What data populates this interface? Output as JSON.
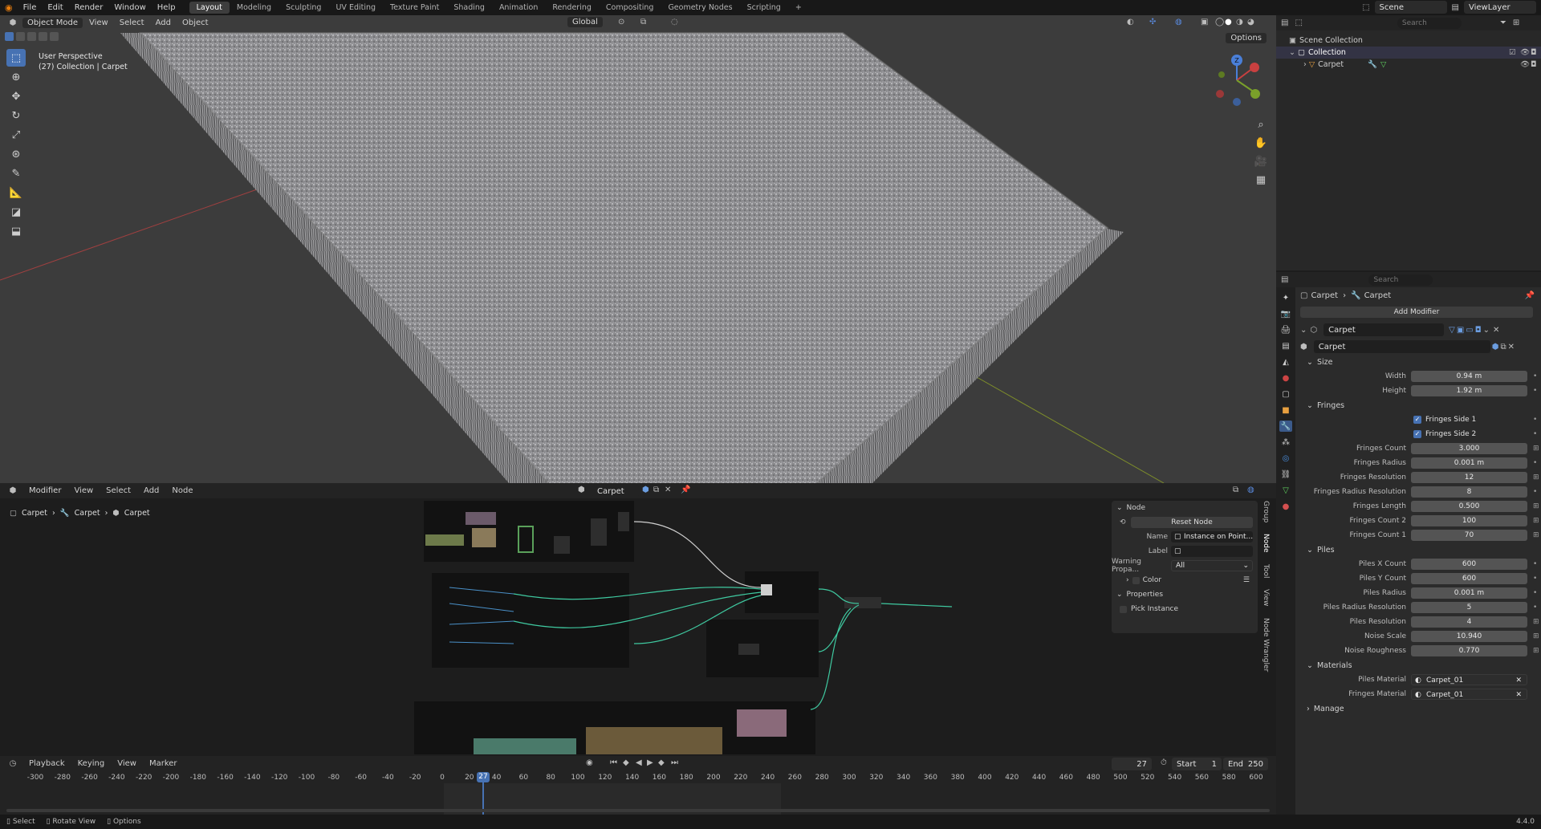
{
  "topbar": {
    "menus": [
      "File",
      "Edit",
      "Render",
      "Window",
      "Help"
    ],
    "workspaces": [
      "Layout",
      "Modeling",
      "Sculpting",
      "UV Editing",
      "Texture Paint",
      "Shading",
      "Animation",
      "Rendering",
      "Compositing",
      "Geometry Nodes",
      "Scripting"
    ],
    "active_workspace": "Layout",
    "scene": "Scene",
    "view_layer": "ViewLayer"
  },
  "viewport": {
    "mode": "Object Mode",
    "menus": [
      "View",
      "Select",
      "Add",
      "Object"
    ],
    "transform_orientation": "Global",
    "options": "Options",
    "info_line1": "User Perspective",
    "info_line2": "(27) Collection | Carpet",
    "gizmo_z": "Z"
  },
  "outliner": {
    "search_placeholder": "Search",
    "scene_collection": "Scene Collection",
    "collection": "Collection",
    "object": "Carpet"
  },
  "properties": {
    "search_placeholder": "Search",
    "breadcrumb": [
      "Carpet",
      "Carpet"
    ],
    "add_modifier": "Add Modifier",
    "modifier_name": "Carpet",
    "node_group": "Carpet",
    "size_section": "Size",
    "width_label": "Width",
    "width_value": "0.94 m",
    "height_label": "Height",
    "height_value": "1.92 m",
    "fringes_section": "Fringes",
    "fringes_side1": "Fringes Side 1",
    "fringes_side2": "Fringes Side 2",
    "fringe_rows": [
      {
        "label": "Fringes Count",
        "value": "3.000"
      },
      {
        "label": "Fringes Radius",
        "value": "0.001 m"
      },
      {
        "label": "Fringes Resolution",
        "value": "12"
      },
      {
        "label": "Fringes Radius Resolution",
        "value": "8"
      },
      {
        "label": "Fringes Length",
        "value": "0.500"
      },
      {
        "label": "Fringes Count 2",
        "value": "100"
      },
      {
        "label": "Fringes Count 1",
        "value": "70"
      }
    ],
    "piles_section": "Piles",
    "pile_rows": [
      {
        "label": "Piles X Count",
        "value": "600"
      },
      {
        "label": "Piles Y Count",
        "value": "600"
      },
      {
        "label": "Piles Radius",
        "value": "0.001 m"
      },
      {
        "label": "Piles Radius Resolution",
        "value": "5"
      },
      {
        "label": "Piles Resolution",
        "value": "4"
      },
      {
        "label": "Noise Scale",
        "value": "10.940"
      },
      {
        "label": "Noise Roughness",
        "value": "0.770"
      }
    ],
    "materials_section": "Materials",
    "piles_material_label": "Piles Material",
    "piles_material": "Carpet_01",
    "fringes_material_label": "Fringes Material",
    "fringes_material": "Carpet_01",
    "manage_section": "Manage"
  },
  "node_editor": {
    "editor_type": "Modifier",
    "menus": [
      "View",
      "Select",
      "Add",
      "Node"
    ],
    "node_group": "Carpet",
    "breadcrumb": [
      "Carpet",
      "Carpet",
      "Carpet"
    ],
    "panel": {
      "node_section": "Node",
      "reset_node": "Reset Node",
      "name_label": "Name",
      "name_value": "Instance on Point...",
      "label_label": "Label",
      "label_value": "",
      "warning_label": "Warning Propa...",
      "warning_value": "All",
      "color_label": "Color",
      "properties_section": "Properties",
      "pick_instance": "Pick Instance"
    },
    "side_tabs": [
      "Group",
      "Node",
      "Tool",
      "View",
      "Node Wrangler"
    ]
  },
  "timeline": {
    "menus": [
      "Playback",
      "Keying",
      "View",
      "Marker"
    ],
    "current_frame": "27",
    "start_label": "Start",
    "start": "1",
    "end_label": "End",
    "end": "250",
    "playhead": "27",
    "ticks": [
      "-300",
      "-280",
      "-260",
      "-240",
      "-220",
      "-200",
      "-180",
      "-160",
      "-140",
      "-120",
      "-100",
      "-80",
      "-60",
      "-40",
      "-20",
      "0",
      "20",
      "40",
      "60",
      "80",
      "100",
      "120",
      "140",
      "160",
      "180",
      "200",
      "220",
      "240",
      "260",
      "280",
      "300",
      "320",
      "340",
      "360",
      "380",
      "400",
      "420",
      "440",
      "460",
      "480",
      "500",
      "520",
      "540",
      "560",
      "580",
      "600"
    ]
  },
  "statusbar": {
    "select": "Select",
    "rotate": "Rotate View",
    "options": "Options",
    "version": "4.4.0"
  },
  "colors": {
    "accent": "#4772b3",
    "viewport_bg": "#3c3c3c",
    "node_wire": "#3fc9a0"
  }
}
